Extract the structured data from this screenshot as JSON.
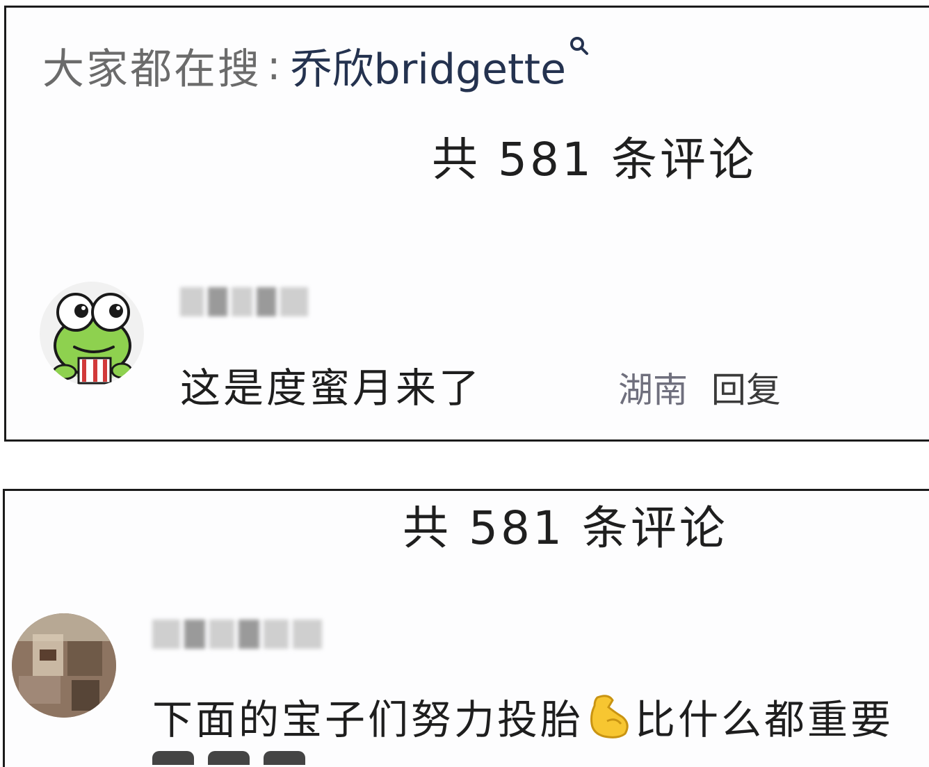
{
  "search": {
    "prefix": "大家都在搜",
    "colon": ":",
    "term": "乔欣bridgette"
  },
  "comments_section_1": {
    "count_label": "共 581 条评论",
    "comment": {
      "text": "这是度蜜月来了",
      "location": "湖南",
      "reply_label": "回复"
    }
  },
  "comments_section_2": {
    "count_label": "共 581 条评论",
    "comment": {
      "text_before_emoji": "下面的宝子们努力投胎",
      "emoji": "💪",
      "text_after_emoji": "比什么都重要"
    }
  },
  "icons": {
    "search": "search-icon",
    "flexed_biceps": "flexed-biceps-icon"
  },
  "colors": {
    "border": "#1b1b1b",
    "search_term": "#24324f",
    "muted": "#6b6b6b"
  }
}
